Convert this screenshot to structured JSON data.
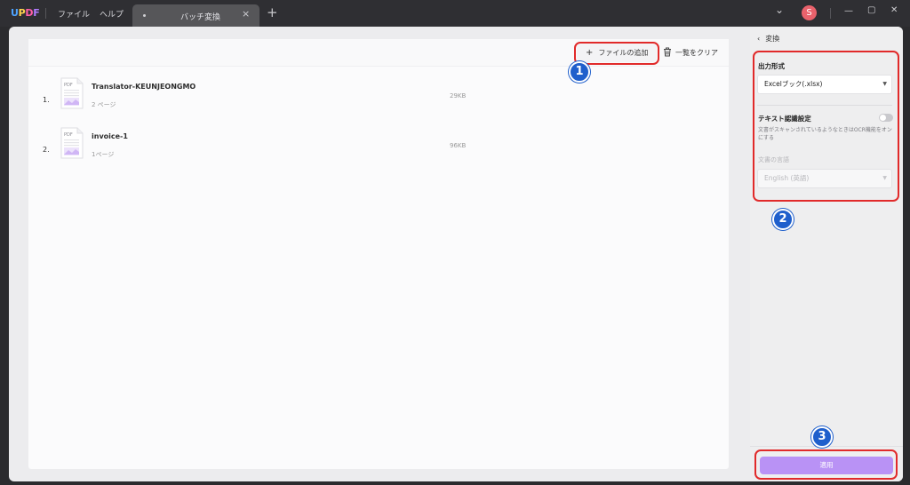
{
  "titlebar": {
    "logo": {
      "u": "U",
      "p": "P",
      "d": "D",
      "f": "F"
    },
    "menu_file": "ファイル",
    "menu_help": "ヘルプ",
    "active_tab": "バッチ変換",
    "tab_close": "×",
    "new_tab": "+",
    "avatar_initial": "S",
    "window_controls": {
      "dropdown": "⌄",
      "minimize": "—",
      "maximize": "▢",
      "close": "✕"
    }
  },
  "toolbar": {
    "add_files_icon": "+",
    "add_files": "ファイルの追加",
    "clear_list": "一覧をクリア"
  },
  "files": [
    {
      "index": "1.",
      "name": "Translator-KEUNJEONGMO",
      "pages": "2 ページ",
      "size": "29KB"
    },
    {
      "index": "2.",
      "name": "invoice-1",
      "pages": "1ページ",
      "size": "96KB"
    }
  ],
  "pdf_icon_label": "PDF",
  "right_panel": {
    "back_icon": "‹",
    "header": "変換",
    "output_format_label": "出力形式",
    "output_format_value": "Excelブック(.xlsx)",
    "ocr_label": "テキスト認識設定",
    "ocr_desc": "文書がスキャンされているようなときはOCR機能をオンにする",
    "ocr_enabled": false,
    "language_label": "文書の言語",
    "language_value": "English (英語)",
    "select_arrow": "▼",
    "apply": "適用"
  },
  "annotations": {
    "badge1": "1",
    "badge2": "2",
    "badge3": "3"
  },
  "colors": {
    "accent": "#b992f5",
    "highlight": "#e12a2a",
    "badge": "#1f5fcc"
  }
}
